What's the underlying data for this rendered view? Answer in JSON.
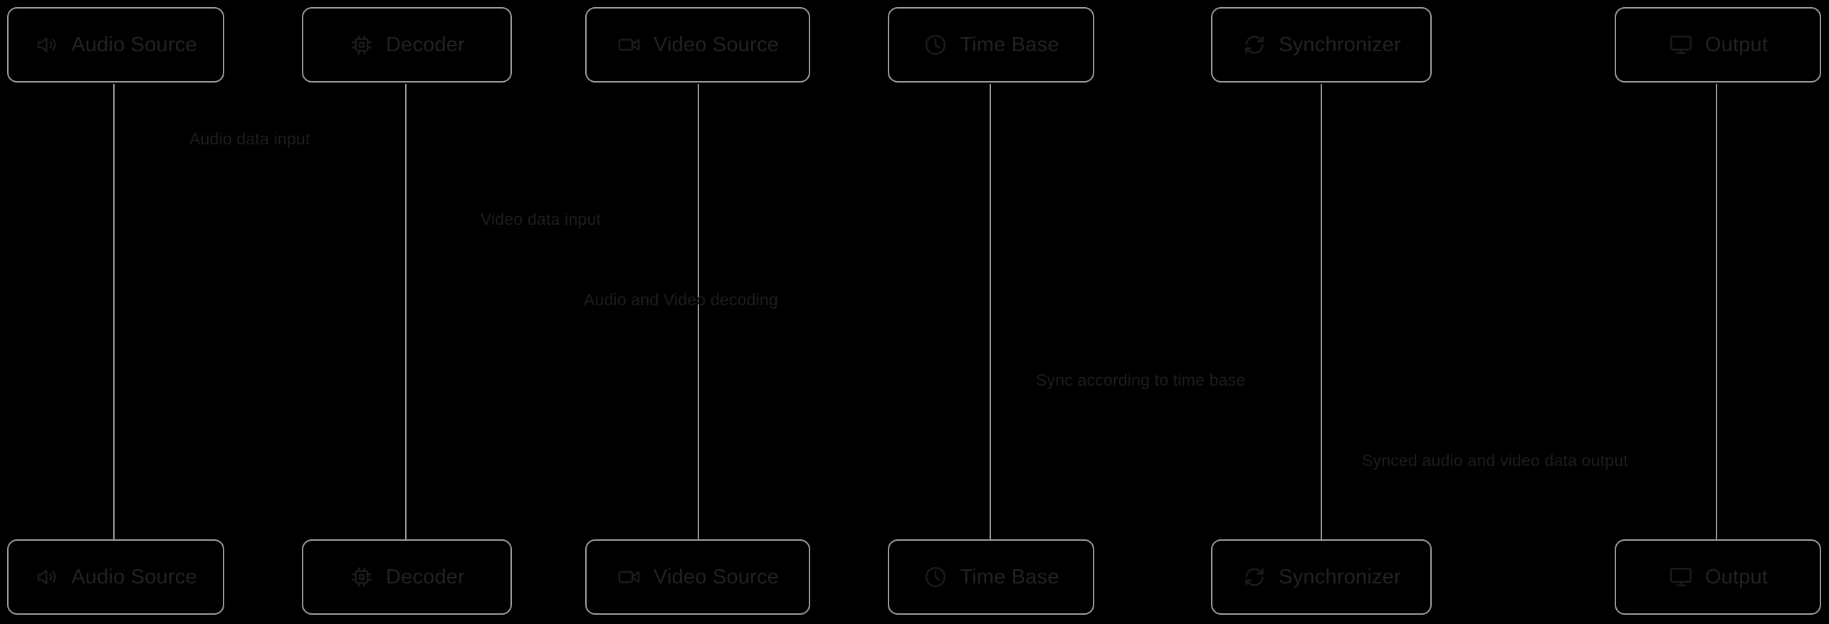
{
  "diagram": {
    "type": "sequence-diagram",
    "background_color": "#000000",
    "box_border_color": "#9b9b9b",
    "lifeline_color": "#9b9b9b",
    "text_color": "#1d1d1d"
  },
  "participants": [
    {
      "id": "audio-source",
      "label": "Audio Source",
      "icon": "speaker-icon"
    },
    {
      "id": "decoder",
      "label": "Decoder",
      "icon": "cpu-chip-icon"
    },
    {
      "id": "video-source",
      "label": "Video Source",
      "icon": "video-camera-icon"
    },
    {
      "id": "time-base",
      "label": "Time Base",
      "icon": "clock-icon"
    },
    {
      "id": "synchronizer",
      "label": "Synchronizer",
      "icon": "refresh-sync-icon"
    },
    {
      "id": "output",
      "label": "Output",
      "icon": "monitor-icon"
    }
  ],
  "messages": [
    {
      "id": "msg-1",
      "label": "Audio data input",
      "from": "audio-source",
      "to": "decoder"
    },
    {
      "id": "msg-2",
      "label": "Video data input",
      "from": "video-source",
      "to": "decoder"
    },
    {
      "id": "msg-3",
      "label": "Audio and Video decoding",
      "from": "decoder",
      "to": "video-source"
    },
    {
      "id": "msg-4",
      "label": "Sync according to time base",
      "from": "time-base",
      "to": "synchronizer"
    },
    {
      "id": "msg-5",
      "label": "Synced audio and video data output",
      "from": "synchronizer",
      "to": "output"
    }
  ]
}
